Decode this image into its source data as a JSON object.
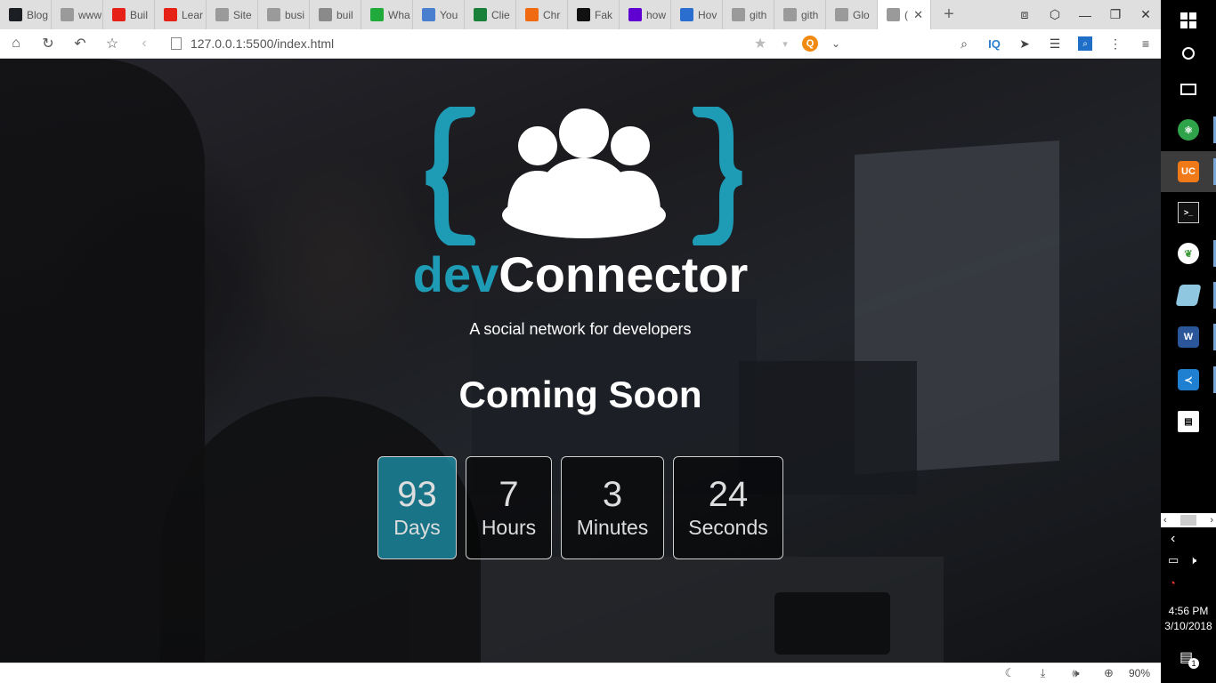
{
  "browser": {
    "tabs": [
      {
        "label": "Blog",
        "icon": "react-icon",
        "color": "#1b1f24"
      },
      {
        "label": "www",
        "icon": "page-icon",
        "color": "#9a9a9a"
      },
      {
        "label": "Buil",
        "icon": "youtube-icon",
        "color": "#e62117"
      },
      {
        "label": "Lear",
        "icon": "youtube-icon",
        "color": "#e62117"
      },
      {
        "label": "Site",
        "icon": "page-icon",
        "color": "#9a9a9a"
      },
      {
        "label": "busi",
        "icon": "page-icon",
        "color": "#9a9a9a"
      },
      {
        "label": "buil",
        "icon": "globe-icon",
        "color": "#8a8a8a"
      },
      {
        "label": "Wha",
        "icon": "whatsapp-icon",
        "color": "#1faa3b"
      },
      {
        "label": "You",
        "icon": "chrome-icon",
        "color": "#4a7fd0"
      },
      {
        "label": "Clie",
        "icon": "sheets-icon",
        "color": "#188038"
      },
      {
        "label": "Chr",
        "icon": "check-icon",
        "color": "#f06a12"
      },
      {
        "label": "Fak",
        "icon": "github-icon",
        "color": "#111111"
      },
      {
        "label": "how",
        "icon": "yahoo-icon",
        "color": "#5f01d1"
      },
      {
        "label": "Hov",
        "icon": "dots-icon",
        "color": "#2a6fd0"
      },
      {
        "label": "gith",
        "icon": "page-icon",
        "color": "#9a9a9a"
      },
      {
        "label": "gith",
        "icon": "page-icon",
        "color": "#9a9a9a"
      },
      {
        "label": "Glo",
        "icon": "page-icon",
        "color": "#9a9a9a"
      },
      {
        "label": "(",
        "icon": "page-icon",
        "color": "#9a9a9a"
      }
    ],
    "close_symbol": "✕",
    "new_tab_symbol": "+",
    "url": "127.0.0.1:5500/index.html",
    "search_engine_letter": "Q",
    "ext_iq": "IQ",
    "window_controls": [
      "⧈",
      "⬡",
      "—",
      "❐",
      "✕"
    ]
  },
  "page": {
    "brand_dev": "dev",
    "brand_connector": "Connector",
    "tagline": "A social network for developers",
    "heading": "Coming Soon",
    "accent_color": "#1e9bb5",
    "countdown": [
      {
        "value": "93",
        "label": "Days",
        "active": true
      },
      {
        "value": "7",
        "label": "Hours",
        "active": false
      },
      {
        "value": "3",
        "label": "Minutes",
        "active": false
      },
      {
        "value": "24",
        "label": "Seconds",
        "active": false
      }
    ]
  },
  "statusbar": {
    "zoom": "90%"
  },
  "taskbar": {
    "time": "4:56 PM",
    "date": "3/10/2018",
    "notification_count": "1"
  }
}
